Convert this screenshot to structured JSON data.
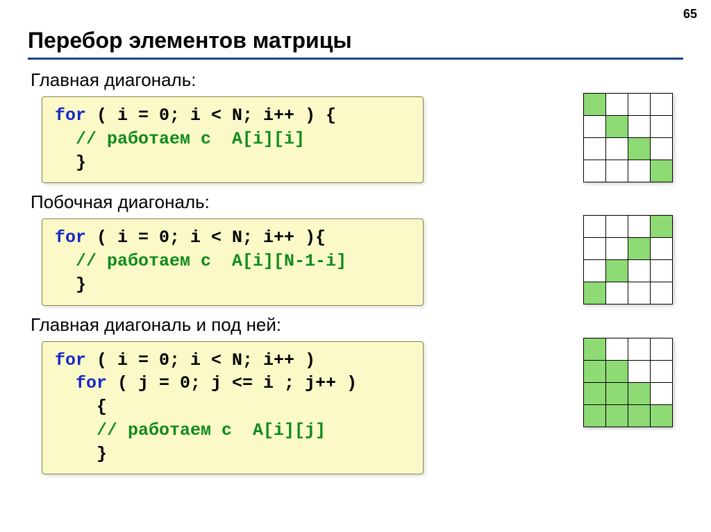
{
  "page_number": "65",
  "title": "Перебор элементов матрицы",
  "sections": [
    {
      "heading": "Главная диагональ:",
      "code": {
        "line1_kw": "for",
        "line1_rest": " ( i = 0; i < N; i++ ) {",
        "line2_cmt": "  // работаем с  A[i][i]",
        "line3": "  }"
      }
    },
    {
      "heading": "Побочная диагональ:",
      "code": {
        "line1_kw": "for",
        "line1_rest": " ( i = 0; i < N; i++ ){",
        "line2_cmt": "  // работаем с  A[i][N-1-i]",
        "line3": "  }"
      }
    },
    {
      "heading": "Главная диагональ и под ней:",
      "code": {
        "line1_kw": "for",
        "line1_rest": " ( i = 0; i < N; i++ )",
        "line2_kw": "  for",
        "line2_rest": " ( j = 0; j <= i ; j++ )",
        "line3": "    {",
        "line4_cmt": "    // работаем с  A[i][j]",
        "line5": "    }"
      }
    }
  ]
}
